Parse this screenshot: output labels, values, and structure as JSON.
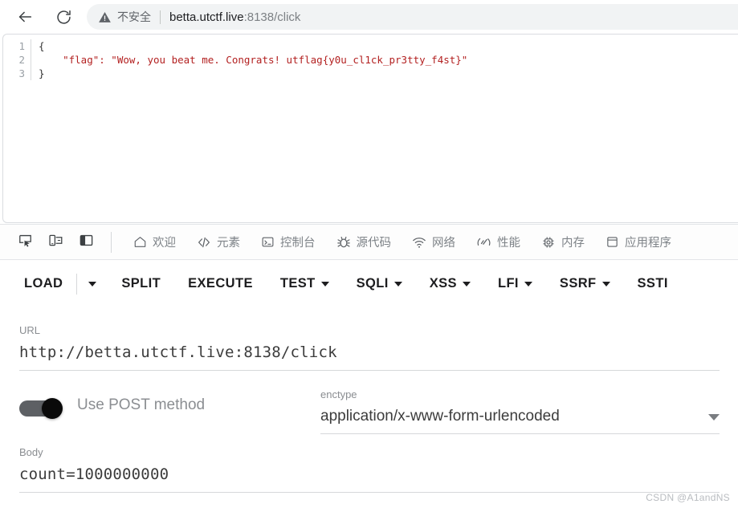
{
  "browser": {
    "back_icon": "arrow-left-icon",
    "reload_icon": "reload-icon",
    "security_icon": "warning-triangle-icon",
    "security_label": "不安全",
    "url_host": "betta.utctf.live",
    "url_path": ":8138/click"
  },
  "json_viewer": {
    "lines": [
      {
        "num": "1",
        "text": "{",
        "kind": "plain"
      },
      {
        "num": "2",
        "text": "    \"flag\": \"Wow, you beat me. Congrats! utflag{y0u_cl1ck_pr3tty_f4st}\"",
        "kind": "string"
      },
      {
        "num": "3",
        "text": "}",
        "kind": "plain"
      }
    ],
    "line_1": "{",
    "line_2": "    \"flag\": \"Wow, you beat me. Congrats! utflag{y0u_cl1ck_pr3tty_f4st}\"",
    "line_3": "}",
    "num_1": "1",
    "num_2": "2",
    "num_3": "3",
    "flag": "utflag{y0u_cl1ck_pr3tty_f4st}"
  },
  "devtools": {
    "tool_icons": [
      {
        "name": "inspect-element-icon"
      },
      {
        "name": "device-toolbar-icon"
      },
      {
        "name": "dock-panel-icon"
      }
    ],
    "tabs": [
      {
        "label": "欢迎",
        "icon": "home-icon"
      },
      {
        "label": "元素",
        "icon": "code-brackets-icon"
      },
      {
        "label": "控制台",
        "icon": "console-prompt-icon"
      },
      {
        "label": "源代码",
        "icon": "bug-icon"
      },
      {
        "label": "网络",
        "icon": "wifi-icon"
      },
      {
        "label": "性能",
        "icon": "gauge-icon"
      },
      {
        "label": "内存",
        "icon": "memory-chip-icon"
      },
      {
        "label": "应用程序",
        "icon": "application-window-icon"
      }
    ]
  },
  "app_toolbar": {
    "items": [
      {
        "label": "LOAD",
        "has_caret": true,
        "caret_separate": true
      },
      {
        "label": "SPLIT",
        "has_caret": false
      },
      {
        "label": "EXECUTE",
        "has_caret": false
      },
      {
        "label": "TEST",
        "has_caret": true
      },
      {
        "label": "SQLI",
        "has_caret": true
      },
      {
        "label": "XSS",
        "has_caret": true
      },
      {
        "label": "LFI",
        "has_caret": true
      },
      {
        "label": "SSRF",
        "has_caret": true
      },
      {
        "label": "SSTI",
        "has_caret": false
      }
    ]
  },
  "form": {
    "url": {
      "label": "URL",
      "value": "http://betta.utctf.live:8138/click"
    },
    "post_toggle": {
      "label": "Use POST method",
      "state": "on"
    },
    "enctype": {
      "label": "enctype",
      "value": "application/x-www-form-urlencoded"
    },
    "body": {
      "label": "Body",
      "value": "count=1000000000"
    }
  },
  "watermark": {
    "text": "CSDN @A1andNS"
  },
  "colors": {
    "json_string": "#b32121",
    "omnibox_bg": "#f1f3f4",
    "toolbar_text": "#1d1d1f",
    "label_gray": "#8a8d91"
  }
}
